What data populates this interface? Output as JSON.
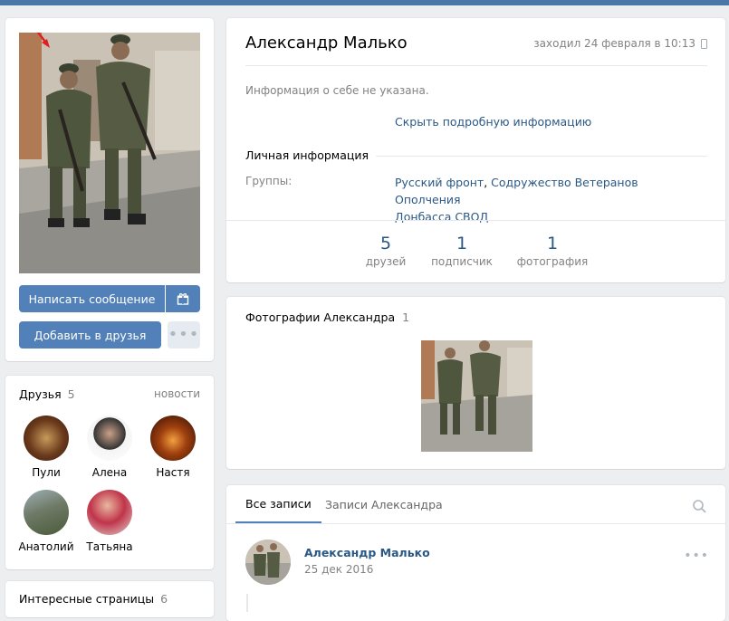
{
  "profile": {
    "name": "Александр Малько",
    "last_seen": "заходил 24 февраля в 10:13",
    "about": "Информация о себе не указана.",
    "toggle_details": "Скрыть подробную информацию",
    "section_personal": "Личная информация",
    "groups_label": "Группы:",
    "groups_line1_a": "Русский фронт",
    "groups_line1_sep": ", ",
    "groups_line1_b": "Содружество Ветеранов Ополчения",
    "groups_line2": "Донбасса СВОД"
  },
  "counters": [
    {
      "value": "5",
      "label": "друзей"
    },
    {
      "value": "1",
      "label": "подписчик"
    },
    {
      "value": "1",
      "label": "фотография"
    }
  ],
  "actions": {
    "send_message": "Написать сообщение",
    "add_friend": "Добавить в друзья",
    "gift_icon": "gift-icon",
    "more_icon": "more-dots-icon"
  },
  "friends_block": {
    "title": "Друзья",
    "count": "5",
    "news_link": "новости",
    "items": [
      {
        "name": "Пули"
      },
      {
        "name": "Алена"
      },
      {
        "name": "Настя"
      },
      {
        "name": "Анатолий"
      },
      {
        "name": "Татьяна"
      }
    ]
  },
  "interesting_pages": {
    "title": "Интересные страницы",
    "count": "6"
  },
  "photos_block": {
    "title": "Фотографии Александра",
    "count": "1"
  },
  "wall": {
    "tabs": [
      "Все записи",
      "Записи Александра"
    ],
    "search_icon": "search-icon",
    "post": {
      "author": "Александр Малько",
      "date": "25 дек 2016",
      "menu_icon": "more-dots-icon"
    }
  },
  "colors": {
    "accent": "#4a76a8",
    "link": "#2a5885",
    "button": "#5181b8",
    "background": "#edeef0"
  }
}
